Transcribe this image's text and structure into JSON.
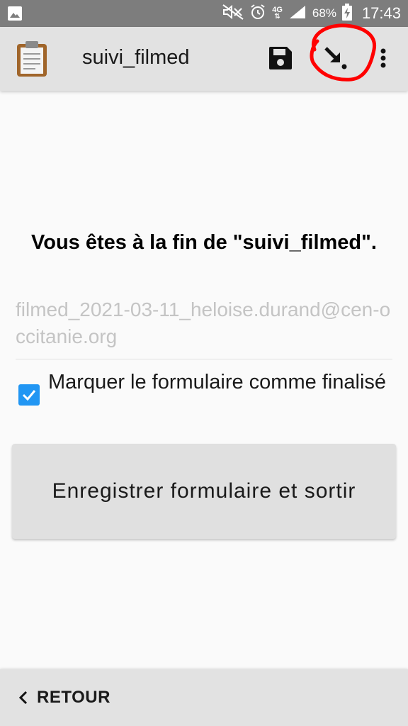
{
  "status_bar": {
    "battery_text": "68%",
    "time": "17:43",
    "network": "4G",
    "icons": [
      "gallery-icon",
      "mute-icon",
      "alarm-icon",
      "signal-icon",
      "battery-charging-icon"
    ]
  },
  "app_bar": {
    "title": "suivi_filmed",
    "actions": [
      "save-icon",
      "jump-to-end-icon",
      "more-options-icon"
    ]
  },
  "main": {
    "heading": "Vous êtes à la fin de \"suivi_filmed\".",
    "form_name_value": "filmed_2021-03-11_heloise.durand@cen-occitanie.org",
    "checkbox": {
      "label": "Marquer le formulaire comme finalisé",
      "checked": true
    },
    "save_button_label": "Enregistrer formulaire et sortir"
  },
  "bottom_bar": {
    "back_label": "RETOUR"
  },
  "colors": {
    "status_bar": "#7d7d7d",
    "app_bar": "#e2e2e2",
    "checkbox_accent": "#2196f3",
    "annotation_red": "#ff0000"
  }
}
